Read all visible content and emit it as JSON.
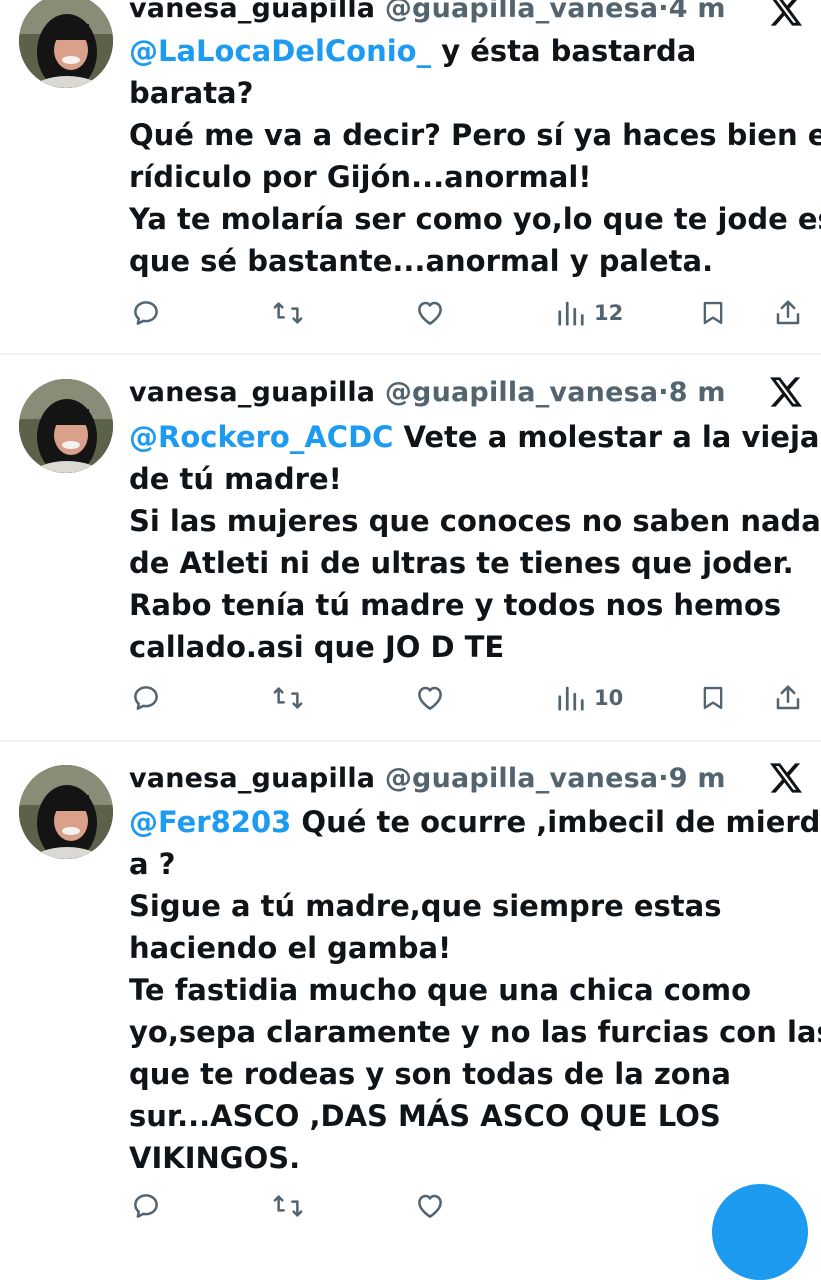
{
  "colors": {
    "accent": "#1d9bf0",
    "text": "#0f1419",
    "secondary": "#536471",
    "divider": "#eff3f4"
  },
  "tweets": [
    {
      "name": "vanesa_guapilla",
      "handle": "@guapilla_vanesa",
      "separator": "·",
      "time": "4 m",
      "mention": "@LaLocaDelConio_",
      "lines": [
        " y ésta bastarda",
        "barata?",
        "Qué me va a decir? Pero sí ya haces bien el",
        "rídiculo por Gijón...anormal!",
        "Ya te molaría ser como yo,lo que te jode es",
        "que sé bastante...anormal y paleta."
      ],
      "views": "12"
    },
    {
      "name": "vanesa_guapilla",
      "handle": "@guapilla_vanesa",
      "separator": "·",
      "time": "8 m",
      "mention": "@Rockero_ACDC",
      "lines": [
        " Vete a molestar a la vieja",
        "de tú madre!",
        "Si las mujeres que conoces no saben nada",
        "de Atleti ni de ultras te tienes que joder.",
        "Rabo tenía tú madre y todos nos hemos",
        "callado.asi que JO D TE"
      ],
      "views": "10"
    },
    {
      "name": "vanesa_guapilla",
      "handle": "@guapilla_vanesa",
      "separator": "·",
      "time": "9 m",
      "mention": "@Fer8203",
      "lines": [
        " Qué te ocurre ,imbecil de mierd",
        "a ?",
        "Sigue a tú madre,que siempre estas",
        "haciendo el gamba!",
        "Te fastidia mucho que una chica como",
        "yo,sepa claramente y no las furcias con las",
        "que te rodeas y son todas de la zona",
        "sur...ASCO ,DAS MÁS ASCO QUE LOS",
        "VIKINGOS."
      ],
      "views": ""
    }
  ],
  "icons": {
    "reply": "reply-icon",
    "retweet": "retweet-icon",
    "like": "heart-icon",
    "views": "views-icon",
    "bookmark": "bookmark-icon",
    "share": "share-icon",
    "platform": "x-logo-icon",
    "compose": "compose-fab"
  }
}
